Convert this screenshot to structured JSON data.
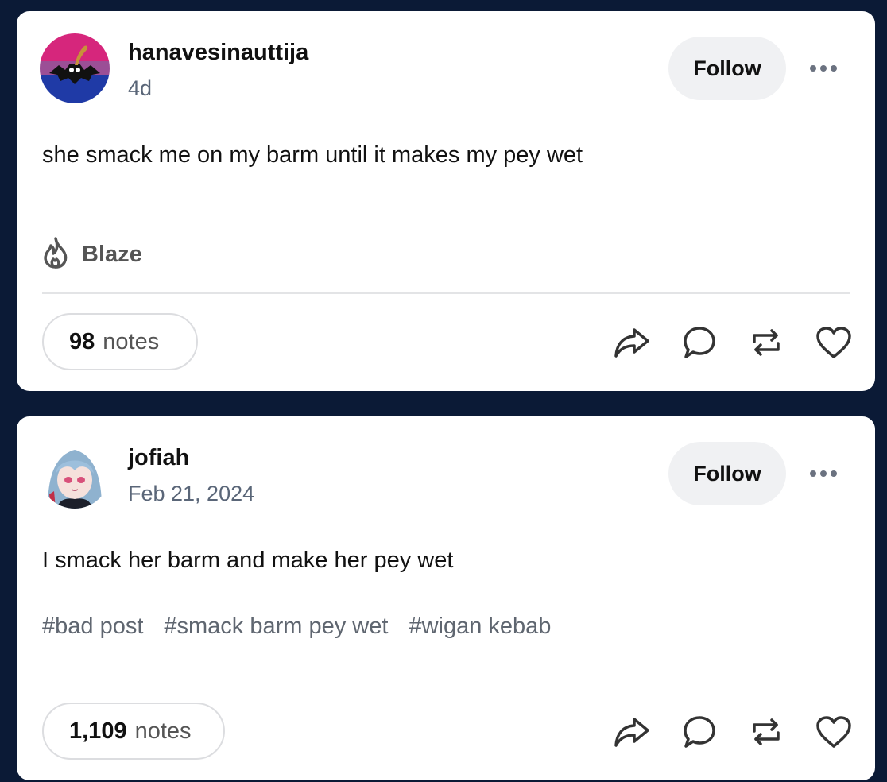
{
  "posts": [
    {
      "username": "hanavesinauttija",
      "timestamp": "4d",
      "follow_label": "Follow",
      "body": "she smack me on my barm until it makes my pey wet",
      "blaze_label": "Blaze",
      "notes_count": "98",
      "notes_word": "notes",
      "avatar_icon": "bat-on-bi-flag-avatar"
    },
    {
      "username": "jofiah",
      "timestamp": "Feb 21, 2024",
      "follow_label": "Follow",
      "body": "I smack her barm and make her pey wet",
      "tags": [
        "#bad post",
        "#smack barm pey wet",
        "#wigan kebab"
      ],
      "notes_count": "1,109",
      "notes_word": "notes",
      "avatar_icon": "anime-character-avatar"
    }
  ],
  "icons": {
    "more": "more-options-icon",
    "blaze": "flame-icon",
    "share": "share-icon",
    "comment": "comment-icon",
    "reblog": "reblog-icon",
    "like": "heart-icon"
  },
  "colors": {
    "background": "#0b1a36",
    "card": "#ffffff",
    "follow_bg": "#f0f1f3",
    "muted_text": "#5a6678"
  }
}
